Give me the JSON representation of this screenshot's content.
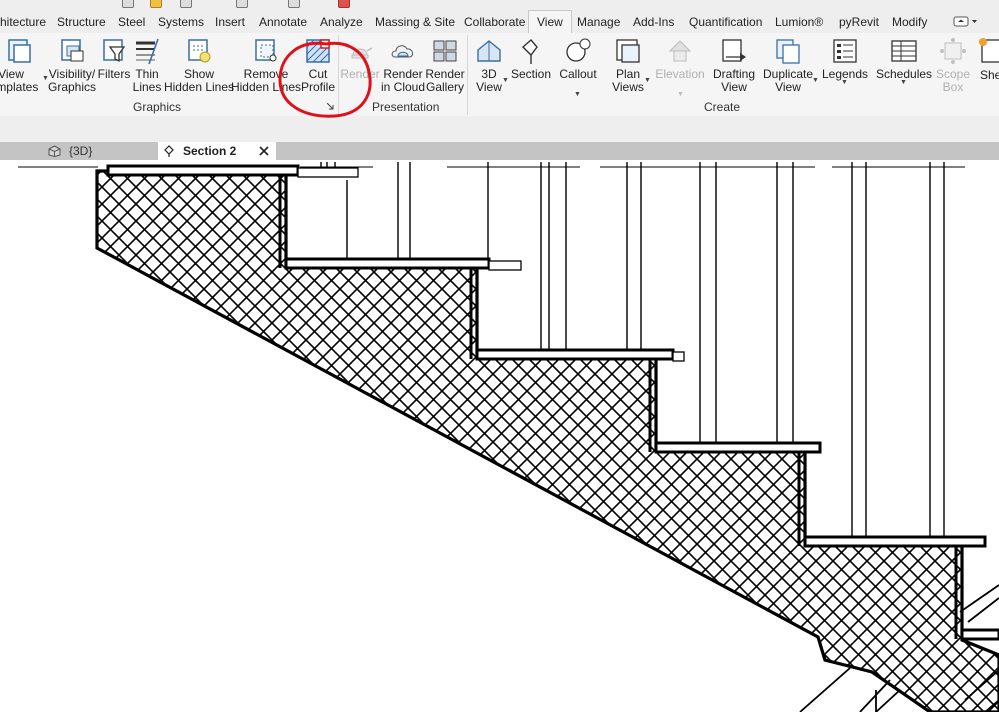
{
  "ribbon_tabs": [
    {
      "label": "hitecture"
    },
    {
      "label": "Structure"
    },
    {
      "label": "Steel"
    },
    {
      "label": "Systems"
    },
    {
      "label": "Insert"
    },
    {
      "label": "Annotate"
    },
    {
      "label": "Analyze"
    },
    {
      "label": "Massing & Site"
    },
    {
      "label": "Collaborate"
    },
    {
      "label": "View"
    },
    {
      "label": "Manage"
    },
    {
      "label": "Add-Ins"
    },
    {
      "label": "Quantification"
    },
    {
      "label": "Lumion®"
    },
    {
      "label": "pyRevit"
    },
    {
      "label": "Modify"
    }
  ],
  "active_tab": "View",
  "tools": {
    "view_templates": "View\nTemplates",
    "visibility_graphics": "Visibility/\nGraphics",
    "filters": "Filters",
    "thin_lines": "Thin\nLines",
    "show_hidden_lines": "Show\nHidden Lines",
    "remove_hidden_lines": "Remove\nHidden Lines",
    "cut_profile": "Cut\nProfile",
    "render": "Render",
    "render_in_cloud": "Render\nin Cloud",
    "render_gallery": "Render\nGallery",
    "view_3d": "3D\nView",
    "section": "Section",
    "callout": "Callout",
    "plan_views": "Plan\nViews",
    "elevation": "Elevation",
    "drafting_view": "Drafting\nView",
    "duplicate_view": "Duplicate\nView",
    "legends": "Legends",
    "schedules": "Schedules",
    "scope_box": "Scope\nBox",
    "sheet": "Shee"
  },
  "panels": {
    "graphics": "Graphics",
    "presentation": "Presentation",
    "create": "Create"
  },
  "view_tabs": [
    {
      "label": "{3D}",
      "active": false,
      "icon": "cube-icon"
    },
    {
      "label": "Section 2",
      "active": true,
      "icon": "section-view-icon"
    }
  ],
  "annotation": {
    "color": "#e0101a",
    "target": "cut_profile"
  },
  "icons": {
    "panel_launcher": "dialog-launcher-icon",
    "close": "close-icon",
    "ribbon_toggle": "ribbon-toggle-icon"
  }
}
